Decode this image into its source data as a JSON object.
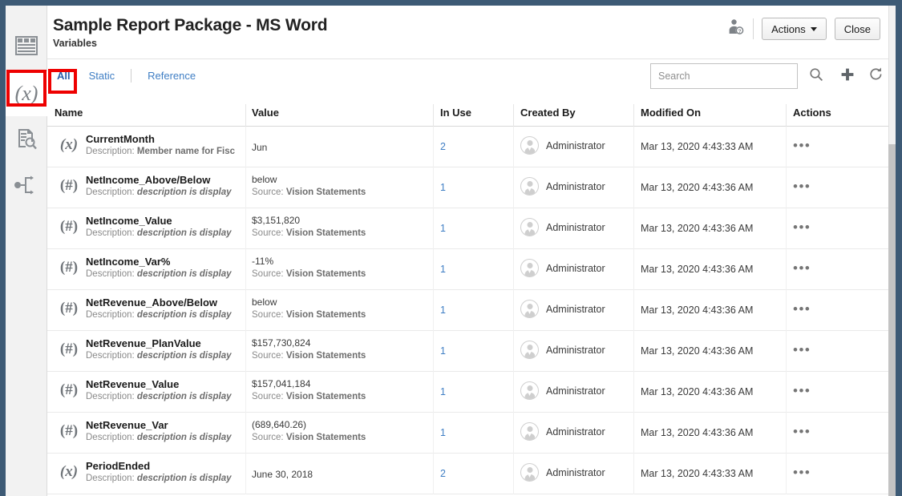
{
  "window": {
    "accent_color": "#3d5a75",
    "annotation_color": "#ee0000"
  },
  "sidebar": {
    "items": [
      {
        "name": "report-package-icon",
        "glyph": "▤",
        "label": "Report Package",
        "active": false
      },
      {
        "name": "variables-icon",
        "glyph": "(x)",
        "label": "Variables",
        "active": true
      },
      {
        "name": "review-icon",
        "glyph": "▣",
        "label": "Review",
        "active": false
      },
      {
        "name": "workflow-icon",
        "glyph": "⇢",
        "label": "Workflow",
        "active": false
      }
    ]
  },
  "header": {
    "title": "Sample Report Package - MS Word",
    "subtitle": "Variables",
    "user_icon": "user-properties-icon",
    "actions_label": "Actions",
    "close_label": "Close"
  },
  "toolbar": {
    "tabs": [
      {
        "label": "All",
        "active": true
      },
      {
        "label": "Static",
        "active": false
      },
      {
        "label": "Reference",
        "active": false
      }
    ],
    "search": {
      "placeholder": "Search",
      "value": ""
    },
    "icons": [
      {
        "name": "search-icon",
        "label": "Search"
      },
      {
        "name": "add-icon",
        "label": "Add"
      },
      {
        "name": "refresh-icon",
        "label": "Refresh"
      }
    ]
  },
  "table": {
    "columns": [
      "Name",
      "Value",
      "In Use",
      "Created By",
      "Modified On",
      "Actions"
    ],
    "description_label": "Description:",
    "source_label": "Source:",
    "actions_glyph": "•••",
    "rows": [
      {
        "icon": "(x)",
        "type": "static",
        "name": "CurrentMonth",
        "description": "Member name for Fisc",
        "description_italic": false,
        "value": "Jun",
        "source": "",
        "in_use": "2",
        "created_by": "Administrator",
        "modified_on": "Mar 13, 2020 4:43:33 AM"
      },
      {
        "icon": "(#)",
        "type": "reference",
        "name": "NetIncome_Above/Below",
        "description": "description is display",
        "description_italic": true,
        "value": "below",
        "source": "Vision Statements",
        "in_use": "1",
        "created_by": "Administrator",
        "modified_on": "Mar 13, 2020 4:43:36 AM"
      },
      {
        "icon": "(#)",
        "type": "reference",
        "name": "NetIncome_Value",
        "description": "description is display",
        "description_italic": true,
        "value": "$3,151,820",
        "source": "Vision Statements",
        "in_use": "1",
        "created_by": "Administrator",
        "modified_on": "Mar 13, 2020 4:43:36 AM"
      },
      {
        "icon": "(#)",
        "type": "reference",
        "name": "NetIncome_Var%",
        "description": "description is display",
        "description_italic": true,
        "value": "-11%",
        "source": "Vision Statements",
        "in_use": "1",
        "created_by": "Administrator",
        "modified_on": "Mar 13, 2020 4:43:36 AM"
      },
      {
        "icon": "(#)",
        "type": "reference",
        "name": "NetRevenue_Above/Below",
        "description": "description is display",
        "description_italic": true,
        "value": "below",
        "source": "Vision Statements",
        "in_use": "1",
        "created_by": "Administrator",
        "modified_on": "Mar 13, 2020 4:43:36 AM"
      },
      {
        "icon": "(#)",
        "type": "reference",
        "name": "NetRevenue_PlanValue",
        "description": "description is display",
        "description_italic": true,
        "value": "$157,730,824",
        "source": "Vision Statements",
        "in_use": "1",
        "created_by": "Administrator",
        "modified_on": "Mar 13, 2020 4:43:36 AM"
      },
      {
        "icon": "(#)",
        "type": "reference",
        "name": "NetRevenue_Value",
        "description": "description is display",
        "description_italic": true,
        "value": "$157,041,184",
        "source": "Vision Statements",
        "in_use": "1",
        "created_by": "Administrator",
        "modified_on": "Mar 13, 2020 4:43:36 AM"
      },
      {
        "icon": "(#)",
        "type": "reference",
        "name": "NetRevenue_Var",
        "description": "description is display",
        "description_italic": true,
        "value": "(689,640.26)",
        "source": "Vision Statements",
        "in_use": "1",
        "created_by": "Administrator",
        "modified_on": "Mar 13, 2020 4:43:36 AM"
      },
      {
        "icon": "(x)",
        "type": "static",
        "name": "PeriodEnded",
        "description": "description is display",
        "description_italic": true,
        "value": "June 30, 2018",
        "source": "",
        "in_use": "2",
        "created_by": "Administrator",
        "modified_on": "Mar 13, 2020 4:43:33 AM"
      }
    ]
  }
}
